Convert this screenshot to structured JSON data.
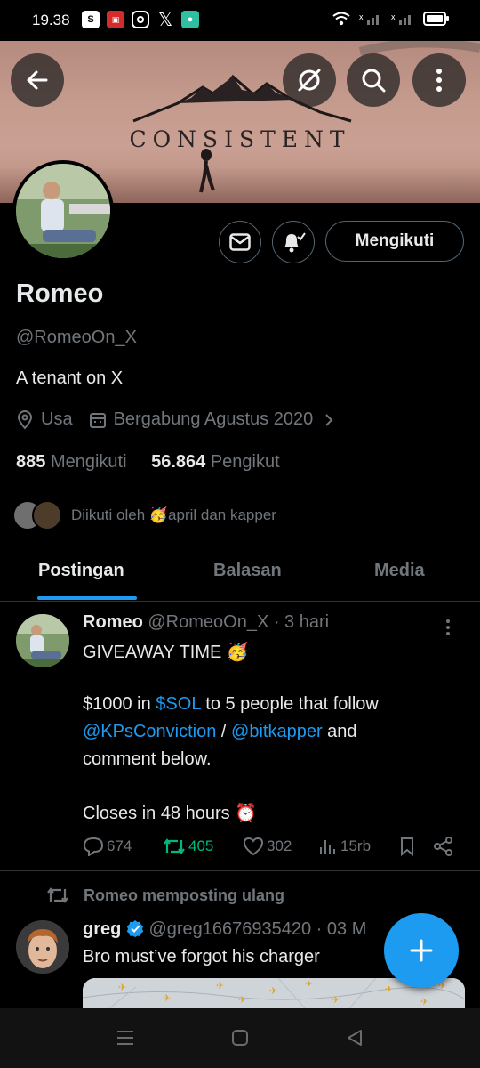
{
  "status_bar": {
    "time": "19.38"
  },
  "banner": {
    "text": "CONSISTENT"
  },
  "profile": {
    "name": "Romeo",
    "handle": "@RomeoOn_X",
    "bio": "A tenant on X",
    "location": "Usa",
    "joined": "Bergabung Agustus 2020",
    "following_count": "885",
    "following_label": "Mengikuti",
    "followers_count": "56.864",
    "followers_label": "Pengikut",
    "followed_by": "Diikuti oleh 🥳april dan kapper",
    "follow_button": "Mengikuti"
  },
  "tabs": [
    {
      "label": "Postingan",
      "active": true
    },
    {
      "label": "Balasan",
      "active": false
    },
    {
      "label": "Media",
      "active": false
    }
  ],
  "tweet1": {
    "author": "Romeo",
    "handle_time": "@RomeoOn_X · 3 hari",
    "line1": "GIVEAWAY TIME 🥳",
    "line2_a": "$1000 in ",
    "line2_link": "$SOL",
    "line2_b": " to 5 people that follow",
    "line3_link1": "@KPsConviction",
    "line3_sep": " / ",
    "line3_link2": "@bitkapper",
    "line3_b": " and",
    "line4": "comment below.",
    "line5": "Closes in 48 hours ⏰",
    "replies": "674",
    "retweets": "405",
    "likes": "302",
    "views": "15rb"
  },
  "tweet2": {
    "retweet_label": "Romeo memposting ulang",
    "author": "greg",
    "handle_time": "@greg16676935420 · 03 M",
    "text": "Bro must’ve forgot his charger"
  },
  "colors": {
    "accent": "#1d9bf0",
    "retweet_green": "#00ba7c",
    "muted": "#71767b"
  }
}
